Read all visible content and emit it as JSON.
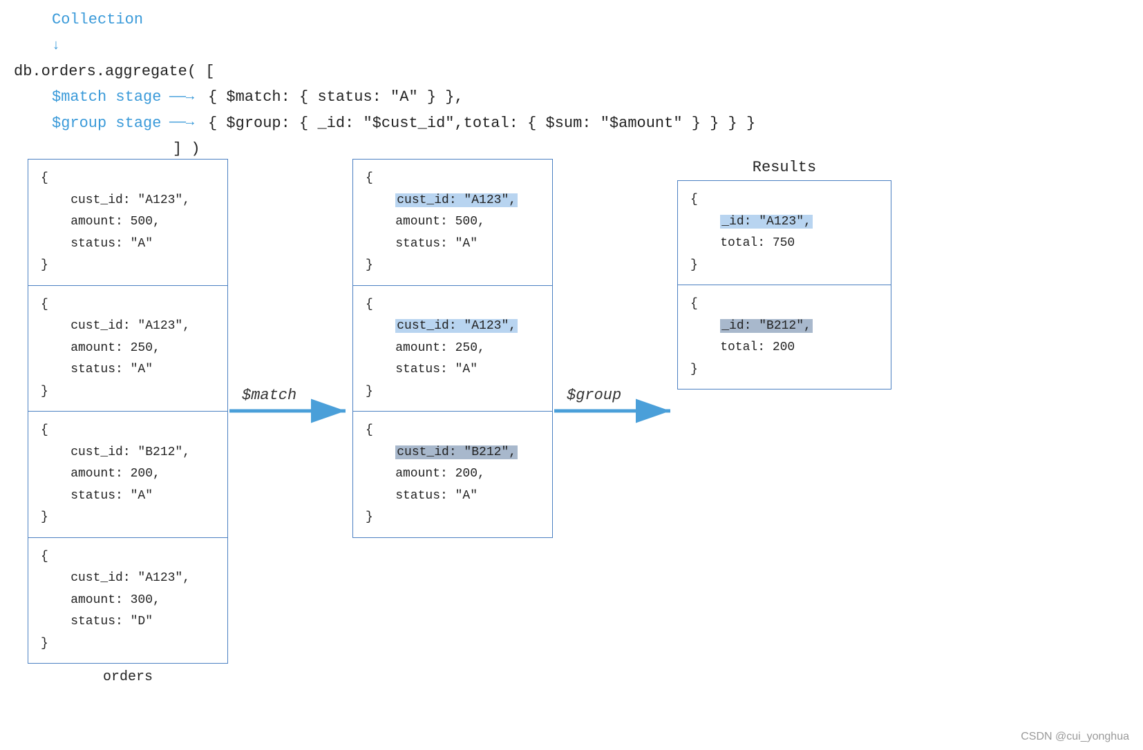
{
  "header": {
    "collection_label": "Collection",
    "arrow_down": "↓",
    "line1": "db.orders.aggregate( [",
    "match_stage_label": "$match stage",
    "match_stage_arrow": "——→",
    "match_stage_code": "{ $match: { status: \"A\" } },",
    "group_stage_label": "$group stage",
    "group_stage_arrow": "——→",
    "group_stage_code": "{ $group: { _id: \"$cust_id\",total: { $sum: \"$amount\" } } } }",
    "line_end": "] )"
  },
  "collection_docs": [
    {
      "lines": [
        "{",
        "    cust_id: \"A123\",",
        "    amount: 500,",
        "    status: \"A\"",
        "}"
      ],
      "highlight": "cust_id: \"A123\","
    },
    {
      "lines": [
        "{",
        "    cust_id: \"A123\",",
        "    amount: 250,",
        "    status: \"A\"",
        "}"
      ],
      "highlight": "cust_id: \"A123\","
    },
    {
      "lines": [
        "{",
        "    cust_id: \"B212\",",
        "    amount: 200,",
        "    status: \"A\"",
        "}"
      ],
      "highlight": "cust_id: \"B212\","
    },
    {
      "lines": [
        "{",
        "    cust_id: \"A123\",",
        "    amount: 300,",
        "    status: \"D\"",
        "}"
      ],
      "highlight": null
    }
  ],
  "collection_name": "orders",
  "match_label": "$match",
  "match_docs": [
    {
      "lines": [
        "{",
        "    cust_id: \"A123\",",
        "    amount: 500,",
        "    status: \"A\"",
        "}"
      ],
      "highlight": "cust_id: \"A123\","
    },
    {
      "lines": [
        "{",
        "    cust_id: \"A123\",",
        "    amount: 250,",
        "    status: \"A\"",
        "}"
      ],
      "highlight": "cust_id: \"A123\","
    },
    {
      "lines": [
        "{",
        "    cust_id: \"B212\",",
        "    amount: 200,",
        "    status: \"A\"",
        "}"
      ],
      "highlight": "cust_id: \"B212\","
    }
  ],
  "group_label": "$group",
  "results_title": "Results",
  "results_docs": [
    {
      "lines": [
        "{",
        "    _id: \"A123\",",
        "    total: 750",
        "}"
      ],
      "highlight": "_id: \"A123\","
    },
    {
      "lines": [
        "{",
        "    _id: \"B212\",",
        "    total: 200",
        "}"
      ],
      "highlight": "_id: \"B212\","
    }
  ],
  "watermark": "CSDN @cui_yonghua"
}
